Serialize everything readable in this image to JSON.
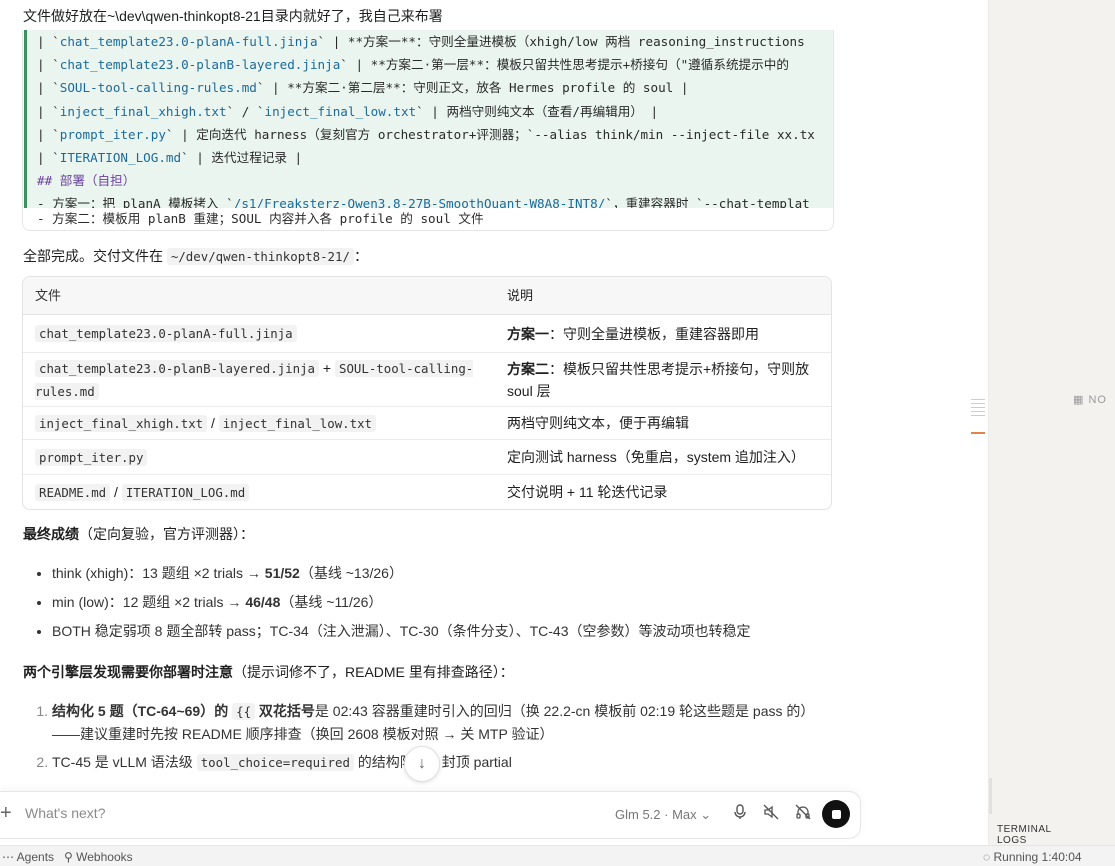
{
  "user_message": "文件做好放在~\\dev\\qwen-thinkopt8-21目录内就好了，我自己来布署",
  "code_block": {
    "lines": [
      {
        "pre": "| `",
        "path": "chat_template23.0-planA-full.jinja",
        "post": "` | **方案一**：守则全量进模板（xhigh/low 两档 reasoning_instructions"
      },
      {
        "pre": "| `",
        "path": "chat_template23.0-planB-layered.jinja",
        "post": "` | **方案二·第一层**：模板只留共性思考提示+桥接句（\"遵循系统提示中的"
      },
      {
        "pre": "| `",
        "path": "SOUL-tool-calling-rules.md",
        "post": "` | **方案二·第二层**：守则正文，放各 Hermes profile 的 soul |"
      },
      {
        "pre": "| `",
        "path": "inject_final_xhigh.txt",
        "mid": "` / `",
        "path2": "inject_final_low.txt",
        "post": "` | 两档守则纯文本（查看/再编辑用） |"
      },
      {
        "pre": "| `",
        "path": "prompt_iter.py",
        "post": "` | 定向迭代 harness（复刻官方 orchestrator+评测器；`--alias think/min --inject-file xx.tx"
      },
      {
        "pre": "| `",
        "path": "ITERATION_LOG.md",
        "post": "` | 迭代过程记录 |"
      },
      {
        "heading": "## 部署（自担）"
      },
      {
        "pre": "- 方案一：把 planA 模板拷入 `",
        "path": "/s1/Freaksterz-Qwen3.8-27B-SmoothQuant-W8A8-INT8/",
        "post": "`，重建容器时 `--chat-templat"
      }
    ],
    "tail": "- 方案二：模板用 planB 重建；SOUL 内容并入各 profile 的 soul 文件"
  },
  "done_text_prefix": "全部完成。交付文件在 ",
  "done_path": "~/dev/qwen-thinkopt8-21/",
  "done_text_suffix": "：",
  "table": {
    "headers": [
      "文件",
      "说明"
    ],
    "rows": [
      {
        "files": [
          "chat_template23.0-planA-full.jinja"
        ],
        "seps": [],
        "desc_bold": "方案一",
        "desc": "：守则全量进模板，重建容器即用"
      },
      {
        "files": [
          "chat_template23.0-planB-layered.jinja",
          "SOUL-tool-calling-rules.md"
        ],
        "seps": [
          " + "
        ],
        "desc_bold": "方案二",
        "desc": "：模板只留共性思考提示+桥接句，守则放 soul 层"
      },
      {
        "files": [
          "inject_final_xhigh.txt",
          "inject_final_low.txt"
        ],
        "seps": [
          " / "
        ],
        "desc_bold": "",
        "desc": "两档守则纯文本，便于再编辑"
      },
      {
        "files": [
          "prompt_iter.py"
        ],
        "seps": [],
        "desc_bold": "",
        "desc": "定向测试 harness（免重启，system 追加注入）"
      },
      {
        "files": [
          "README.md",
          "ITERATION_LOG.md"
        ],
        "seps": [
          " / "
        ],
        "desc_bold": "",
        "desc": "交付说明 + 11 轮迭代记录"
      }
    ]
  },
  "final_score": {
    "bold": "最终成绩",
    "rest": "（定向复验，官方评测器）："
  },
  "bullets": [
    {
      "text": "think (xhigh)：13 题组 ×2 trials → ",
      "bold": "51/52",
      "after": "（基线 ~13/26）"
    },
    {
      "text": "min (low)：12 题组 ×2 trials → ",
      "bold": "46/48",
      "after": "（基线 ~11/26）"
    },
    {
      "text": "BOTH 稳定弱项 8 题全部转 pass；TC-34（注入泄漏）、TC-30（条件分支）、TC-43（空参数）等波动项也转稳定",
      "bold": "",
      "after": ""
    }
  ],
  "engine_note": {
    "bold": "两个引擎层发现需要你部署时注意",
    "rest": "（提示词修不了，README 里有排查路径）："
  },
  "numbered": [
    {
      "bold": "结构化 5 题（TC-64~69）的 ",
      "code": "{{",
      "bold2": " 双花括号",
      "rest": "是 02:43 容器重建时引入的回归（换 22.2-cn 模板前 02:19 轮这些题是 pass 的）——建议重建时先按 README 顺序排查（换回 2608 模板对照 → 关 MTP 验证）"
    },
    {
      "pre": "TC-45 是 vLLM 语法级 ",
      "code": "tool_choice=required",
      "rest": " 的结构限制，封顶 partial"
    }
  ],
  "composer": {
    "placeholder": "What's next?",
    "model": "Glm 5.2 · Max",
    "model_chevron": "⌄"
  },
  "right_panel": {
    "label": "NO",
    "tabs": [
      "TERMINAL",
      "LOGS"
    ]
  },
  "status_bar": {
    "agents": "Agents",
    "webhooks": "Webhooks",
    "running": "Running 1:40:04"
  }
}
